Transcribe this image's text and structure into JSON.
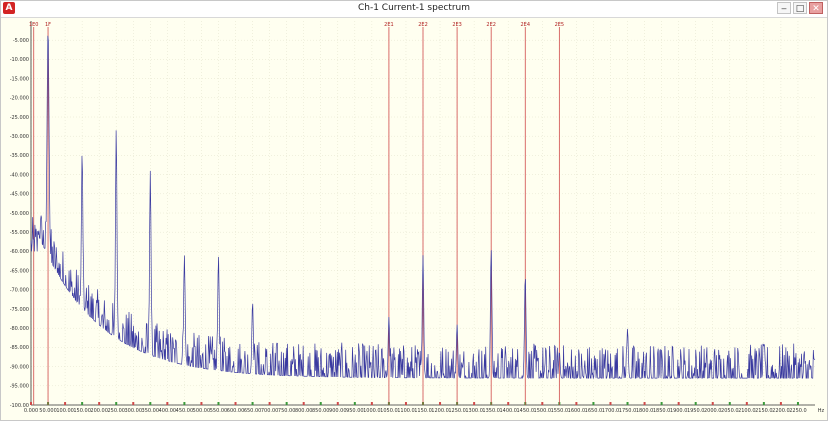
{
  "window": {
    "title": "Ch-1 Current-1 spectrum",
    "app_icon_letter": "A",
    "controls": {
      "minimize": "‒",
      "maximize": "□",
      "close": "✕"
    }
  },
  "colors": {
    "background": "#fffff0",
    "spectrum_line": "#3a3aa0",
    "grid": "#d9d9c2",
    "marker": "#d04a4a",
    "axis": "#333333"
  },
  "chart_data": {
    "type": "line",
    "xlabel": "Hz",
    "ylabel": "",
    "xlim": [
      0,
      2300
    ],
    "ylim": [
      -100,
      0
    ],
    "grid": true,
    "x_ticks": [
      0,
      50,
      100,
      150,
      200,
      250,
      300,
      350,
      400,
      450,
      500,
      550,
      600,
      650,
      700,
      750,
      800,
      850,
      900,
      950,
      1000,
      1050,
      1100,
      1150,
      1200,
      1250,
      1300,
      1350,
      1400,
      1450,
      1500,
      1550,
      1600,
      1650,
      1700,
      1750,
      1800,
      1850,
      1900,
      1950,
      2000,
      2050,
      2100,
      2150,
      2200,
      2250
    ],
    "x_tick_labels": [
      "0.000",
      "50.000",
      "100.00",
      "150.00",
      "200.00",
      "250.00",
      "300.00",
      "350.00",
      "400.00",
      "450.00",
      "500.00",
      "550.00",
      "600.00",
      "650.00",
      "700.00",
      "750.00",
      "800.00",
      "850.00",
      "900.00",
      "950.00",
      "1000.0",
      "1050.0",
      "1100.0",
      "1150.0",
      "1200.0",
      "1250.0",
      "1300.0",
      "1350.0",
      "1400.0",
      "1450.0",
      "1500.0",
      "1550.0",
      "1600.0",
      "1650.0",
      "1700.0",
      "1750.0",
      "1800.0",
      "1850.0",
      "1900.0",
      "1950.0",
      "2000.0",
      "2050.0",
      "2100.0",
      "2150.0",
      "2200.0",
      "2250.0"
    ],
    "y_ticks": [
      -5,
      -10,
      -15,
      -20,
      -25,
      -30,
      -35,
      -40,
      -45,
      -50,
      -55,
      -60,
      -65,
      -70,
      -75,
      -80,
      -85,
      -90,
      -95,
      -100
    ],
    "y_tick_labels": [
      "-5.000",
      "-10.000",
      "-15.000",
      "-20.000",
      "-25.000",
      "-30.000",
      "-35.000",
      "-40.000",
      "-45.000",
      "-50.000",
      "-55.000",
      "-60.000",
      "-65.000",
      "-70.000",
      "-75.000",
      "-80.000",
      "-85.000",
      "-90.000",
      "-95.000",
      "-100.00"
    ],
    "peaks": [
      {
        "x": 50,
        "y": -2
      },
      {
        "x": 150,
        "y": -34
      },
      {
        "x": 250,
        "y": -28
      },
      {
        "x": 350,
        "y": -39
      },
      {
        "x": 450,
        "y": -61
      },
      {
        "x": 550,
        "y": -61
      },
      {
        "x": 650,
        "y": -73
      },
      {
        "x": 1050,
        "y": -77
      },
      {
        "x": 1150,
        "y": -61
      },
      {
        "x": 1250,
        "y": -79
      },
      {
        "x": 1350,
        "y": -59
      },
      {
        "x": 1450,
        "y": -66
      },
      {
        "x": 1550,
        "y": -86
      },
      {
        "x": 1750,
        "y": -80
      },
      {
        "x": 2150,
        "y": -84
      }
    ],
    "markers": [
      {
        "label": "1E0",
        "x": 8
      },
      {
        "label": "1F",
        "x": 50
      },
      {
        "label": "2E1",
        "x": 1050
      },
      {
        "label": "2E2",
        "x": 1150
      },
      {
        "label": "2E3",
        "x": 1250
      },
      {
        "label": "2E2",
        "x": 1350
      },
      {
        "label": "2E4",
        "x": 1450
      },
      {
        "label": "2E5",
        "x": 1550
      }
    ]
  }
}
